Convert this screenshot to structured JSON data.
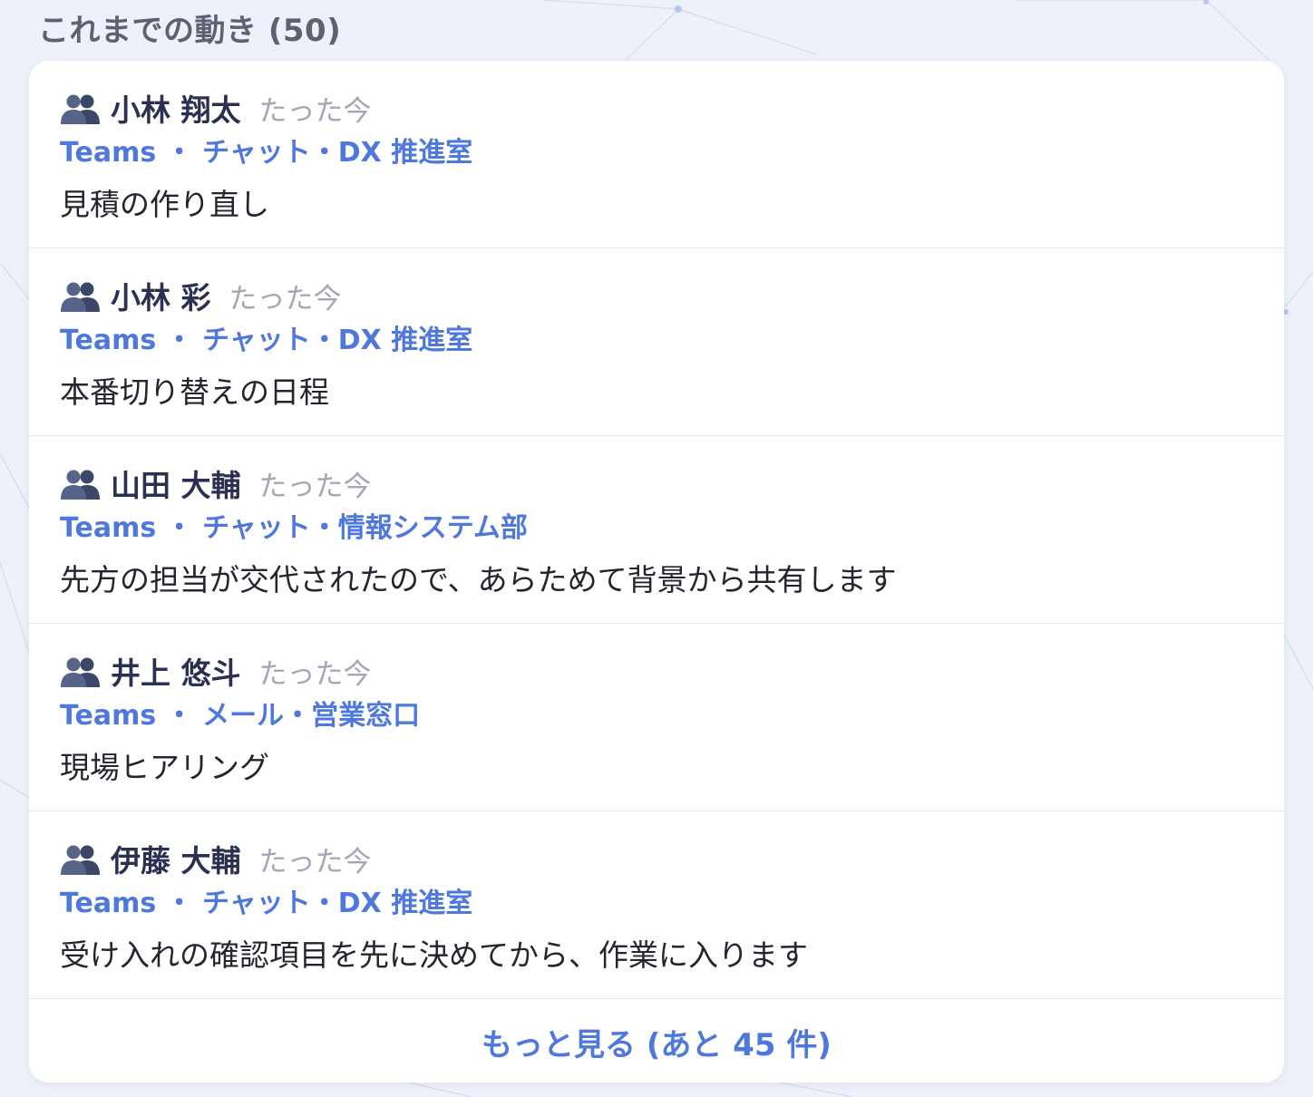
{
  "section": {
    "title": "これまでの動き (50)"
  },
  "icons": {
    "participant": "people-icon"
  },
  "colors": {
    "accent": "#4f78dc",
    "timestamp": "#a3a7b5",
    "name": "#2b3050"
  },
  "items": [
    {
      "author": "小林 翔太",
      "time": "たった今",
      "source": "Teams ・ チャット・DX 推進室",
      "message": "見積の作り直し"
    },
    {
      "author": "小林 彩",
      "time": "たった今",
      "source": "Teams ・ チャット・DX 推進室",
      "message": "本番切り替えの日程"
    },
    {
      "author": "山田 大輔",
      "time": "たった今",
      "source": "Teams ・ チャット・情報システム部",
      "message": "先方の担当が交代されたので、あらためて背景から共有します"
    },
    {
      "author": "井上 悠斗",
      "time": "たった今",
      "source": "Teams ・ メール・営業窓口",
      "message": "現場ヒアリング"
    },
    {
      "author": "伊藤 大輔",
      "time": "たった今",
      "source": "Teams ・ チャット・DX 推進室",
      "message": "受け入れの確認項目を先に決めてから、作業に入ります"
    }
  ],
  "more": {
    "label": "もっと見る (あと 45 件)"
  }
}
